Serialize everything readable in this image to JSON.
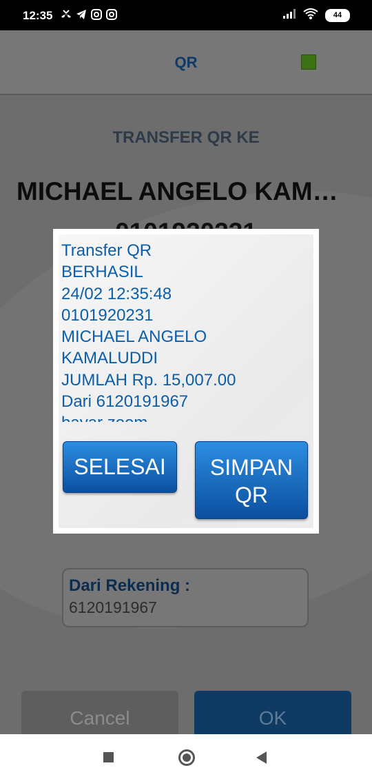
{
  "status_bar": {
    "time": "12:35",
    "battery": "44",
    "icons": [
      "missed-call-icon",
      "telegram-icon",
      "instagram-icon",
      "instagram-icon",
      "signal-icon",
      "wifi-icon",
      "battery-icon"
    ]
  },
  "app_bar": {
    "title": "QR",
    "indicator_color": "#3d6f13"
  },
  "header": {
    "label": "TRANSFER QR KE",
    "name": "MICHAEL ANGELO KAMALU...",
    "account_number_partial": "0101920231"
  },
  "dialog": {
    "lines": [
      "Transfer QR",
      "BERHASIL",
      "24/02 12:35:48",
      "0101920231",
      "MICHAEL ANGELO",
      "KAMALUDDI",
      "JUMLAH Rp. 15,007.00",
      "Dari 6120191967",
      "bayar zoom"
    ],
    "buttons": {
      "done_label": "SELESAI",
      "save_label_line1": "SIMPAN",
      "save_label_line2": "QR"
    },
    "text_color": "#0d5ea8"
  },
  "from_account": {
    "label": "Dari Rekening :",
    "value": "6120191967"
  },
  "actions": {
    "cancel_label": "Cancel",
    "ok_label": "OK"
  },
  "nav_bar": {
    "icons": [
      "recents-icon",
      "home-icon",
      "back-icon"
    ]
  }
}
